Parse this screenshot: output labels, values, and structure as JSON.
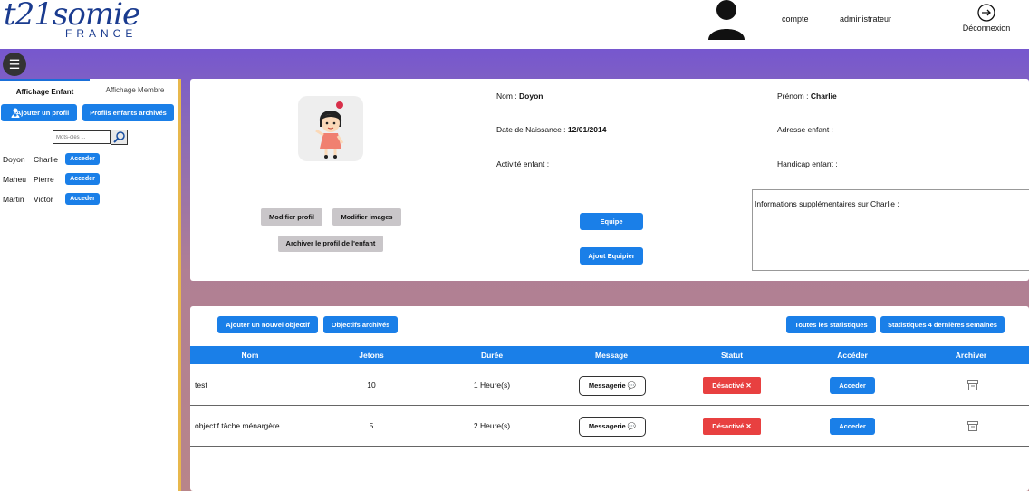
{
  "header": {
    "logo_main": "t21somie",
    "logo_sub": "FRANCE",
    "account_label": "compte",
    "role_label": "administrateur",
    "logout_label": "Déconnexion"
  },
  "menu": {
    "icon": "hamburger-icon",
    "glyph": "☰"
  },
  "sidebar": {
    "tabs": [
      {
        "label": "Affichage Enfant",
        "active": true
      },
      {
        "label": "Affichage Membre",
        "active": false
      }
    ],
    "add_profile_label": "Ajouter un profil",
    "archived_profiles_label": "Profils enfants archivés",
    "search_placeholder": "Mots-clés ...",
    "children": [
      {
        "last": "Doyon",
        "first": "Charlie",
        "action": "Acceder"
      },
      {
        "last": "Maheu",
        "first": "Pierre",
        "action": "Acceder"
      },
      {
        "last": "Martin",
        "first": "Victor",
        "action": "Acceder"
      }
    ]
  },
  "profile": {
    "nom_label": "Nom :",
    "nom_value": "Doyon",
    "prenom_label": "Prénom :",
    "prenom_value": "Charlie",
    "birth_label": "Date de Naissance :",
    "birth_value": "12/01/2014",
    "address_label": "Adresse enfant :",
    "activity_label": "Activité enfant :",
    "handicap_label": "Handicap enfant :",
    "info_label": "Informations supplémentaires sur Charlie :",
    "modify_profile_label": "Modifier profil",
    "modify_images_label": "Modifier images",
    "archive_profile_label": "Archiver le profil de l'enfant",
    "team_label": "Equipe",
    "add_team_label": "Ajout Equipier"
  },
  "objectives": {
    "add_label": "Ajouter un nouvel objectif",
    "archived_label": "Objectifs archivés",
    "all_stats_label": "Toutes les statistiques",
    "recent_stats_label": "Statistiques 4 dernières semaines",
    "columns": [
      "Nom",
      "Jetons",
      "Durée",
      "Message",
      "Statut",
      "Accéder",
      "Archiver"
    ],
    "rows": [
      {
        "nom": "test",
        "jetons": "10",
        "duree": "1 Heure(s)",
        "message": "Messagerie",
        "statut": "Désactivé",
        "acceder": "Acceder"
      },
      {
        "nom": "objectif tâche ménargère",
        "jetons": "5",
        "duree": "2 Heure(s)",
        "message": "Messagerie",
        "statut": "Désactivé",
        "acceder": "Acceder"
      }
    ]
  },
  "colors": {
    "accent_blue": "#1a7fe8",
    "status_red": "#e84040",
    "header_purple": "#6a4bdc",
    "sidebar_border": "#e8b84c"
  }
}
